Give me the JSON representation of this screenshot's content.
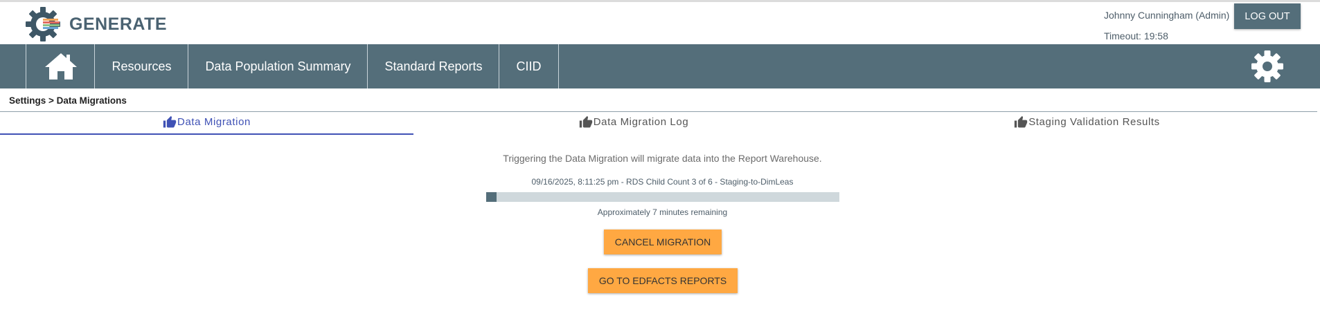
{
  "app": {
    "name": "GENERATE",
    "brand_color": "#546e7a",
    "accent_color": "#3f51b5",
    "action_color": "#ffa842"
  },
  "header": {
    "user": "Johnny Cunningham (Admin)",
    "timeout": "Timeout: 19:58",
    "logout_label": "LOG OUT"
  },
  "nav": {
    "home_icon": "home-icon",
    "items": [
      {
        "label": "Resources"
      },
      {
        "label": "Data Population Summary"
      },
      {
        "label": "Standard Reports"
      },
      {
        "label": "CIID"
      }
    ],
    "settings_icon": "gear-icon"
  },
  "breadcrumb": "Settings > Data Migrations",
  "tabs": [
    {
      "label": "Data Migration",
      "icon": "thumbs-up-icon",
      "active": true
    },
    {
      "label": "Data Migration Log",
      "icon": "thumbs-up-icon",
      "active": false
    },
    {
      "label": "Staging Validation Results",
      "icon": "thumbs-up-icon",
      "active": false
    }
  ],
  "migration": {
    "intro": "Triggering the Data Migration will migrate data into the Report Warehouse.",
    "status": "09/16/2025, 8:11:25 pm - RDS Child Count 3 of 6 - Staging-to-DimLeas",
    "progress_fraction": 0.03,
    "remaining": "Approximately 7 minutes remaining",
    "cancel_label": "CANCEL MIGRATION",
    "edfacts_label": "GO TO EDFACTS REPORTS"
  }
}
